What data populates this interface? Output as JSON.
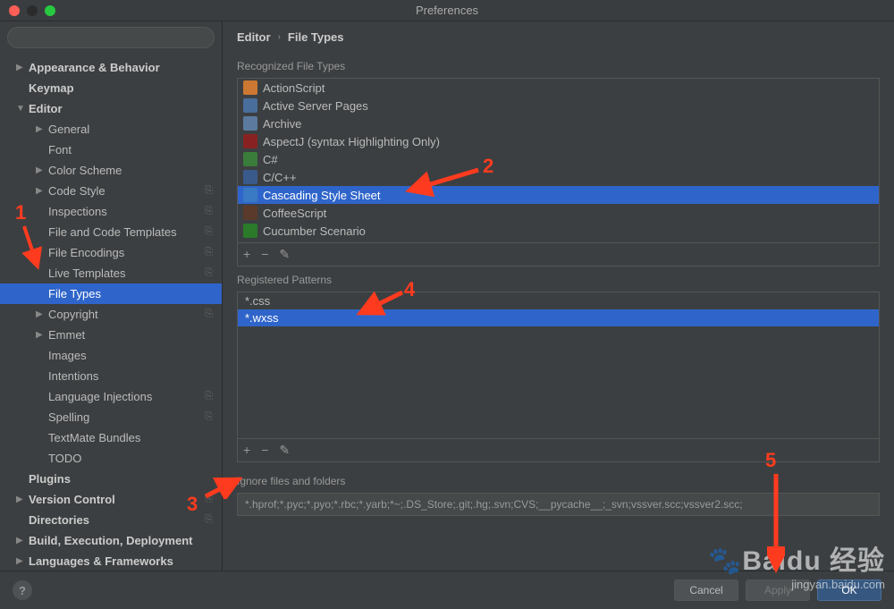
{
  "window": {
    "title": "Preferences"
  },
  "search": {
    "placeholder": ""
  },
  "sidebar": {
    "items": [
      {
        "label": "Appearance & Behavior",
        "level": 1,
        "arrow": "▶",
        "bold": true
      },
      {
        "label": "Keymap",
        "level": 1,
        "arrow": "",
        "bold": true
      },
      {
        "label": "Editor",
        "level": 1,
        "arrow": "▼",
        "bold": true
      },
      {
        "label": "General",
        "level": 2,
        "arrow": "▶",
        "bold": false
      },
      {
        "label": "Font",
        "level": 2,
        "arrow": "",
        "bold": false
      },
      {
        "label": "Color Scheme",
        "level": 2,
        "arrow": "▶",
        "bold": false
      },
      {
        "label": "Code Style",
        "level": 2,
        "arrow": "▶",
        "bold": false,
        "copy": true
      },
      {
        "label": "Inspections",
        "level": 2,
        "arrow": "",
        "bold": false,
        "copy": true
      },
      {
        "label": "File and Code Templates",
        "level": 2,
        "arrow": "",
        "bold": false,
        "copy": true
      },
      {
        "label": "File Encodings",
        "level": 2,
        "arrow": "",
        "bold": false,
        "copy": true
      },
      {
        "label": "Live Templates",
        "level": 2,
        "arrow": "",
        "bold": false,
        "copy": true
      },
      {
        "label": "File Types",
        "level": 2,
        "arrow": "",
        "bold": false,
        "selected": true
      },
      {
        "label": "Copyright",
        "level": 2,
        "arrow": "▶",
        "bold": false,
        "copy": true
      },
      {
        "label": "Emmet",
        "level": 2,
        "arrow": "▶",
        "bold": false
      },
      {
        "label": "Images",
        "level": 2,
        "arrow": "",
        "bold": false
      },
      {
        "label": "Intentions",
        "level": 2,
        "arrow": "",
        "bold": false
      },
      {
        "label": "Language Injections",
        "level": 2,
        "arrow": "",
        "bold": false,
        "copy": true
      },
      {
        "label": "Spelling",
        "level": 2,
        "arrow": "",
        "bold": false,
        "copy": true
      },
      {
        "label": "TextMate Bundles",
        "level": 2,
        "arrow": "",
        "bold": false
      },
      {
        "label": "TODO",
        "level": 2,
        "arrow": "",
        "bold": false
      },
      {
        "label": "Plugins",
        "level": 1,
        "arrow": "",
        "bold": true
      },
      {
        "label": "Version Control",
        "level": 1,
        "arrow": "▶",
        "bold": true,
        "copy": true
      },
      {
        "label": "Directories",
        "level": 1,
        "arrow": "",
        "bold": true,
        "copy": true
      },
      {
        "label": "Build, Execution, Deployment",
        "level": 1,
        "arrow": "▶",
        "bold": true
      },
      {
        "label": "Languages & Frameworks",
        "level": 1,
        "arrow": "▶",
        "bold": true
      }
    ]
  },
  "breadcrumb": {
    "root": "Editor",
    "page": "File Types"
  },
  "sections": {
    "recognized": "Recognized File Types",
    "patterns": "Registered Patterns",
    "ignore": "Ignore files and folders"
  },
  "filetypes": [
    {
      "label": "ActionScript",
      "iconClass": "ic-as"
    },
    {
      "label": "Active Server Pages",
      "iconClass": "ic-asp"
    },
    {
      "label": "Archive",
      "iconClass": "ic-arc"
    },
    {
      "label": "AspectJ (syntax Highlighting Only)",
      "iconClass": "ic-aj"
    },
    {
      "label": "C#",
      "iconClass": "ic-cs"
    },
    {
      "label": "C/C++",
      "iconClass": "ic-cc"
    },
    {
      "label": "Cascading Style Sheet",
      "iconClass": "ic-css",
      "selected": true
    },
    {
      "label": "CoffeeScript",
      "iconClass": "ic-coffee"
    },
    {
      "label": "Cucumber Scenario",
      "iconClass": "ic-cuc"
    }
  ],
  "patterns": [
    {
      "label": "*.css"
    },
    {
      "label": "*.wxss",
      "selected": true
    }
  ],
  "toolbar": {
    "add": "+",
    "remove": "−",
    "edit": "✎"
  },
  "ignore_value": "*.hprof;*.pyc;*.pyo;*.rbc;*.yarb;*~;.DS_Store;.git;.hg;.svn;CVS;__pycache__;_svn;vssver.scc;vssver2.scc;",
  "buttons": {
    "cancel": "Cancel",
    "apply": "Apply",
    "ok": "OK",
    "help": "?"
  },
  "annotations": {
    "n1": "1",
    "n2": "2",
    "n3": "3",
    "n4": "4",
    "n5": "5"
  },
  "watermark": {
    "brand": "Baidu 经验",
    "sub": "jingyan.baidu.com"
  }
}
